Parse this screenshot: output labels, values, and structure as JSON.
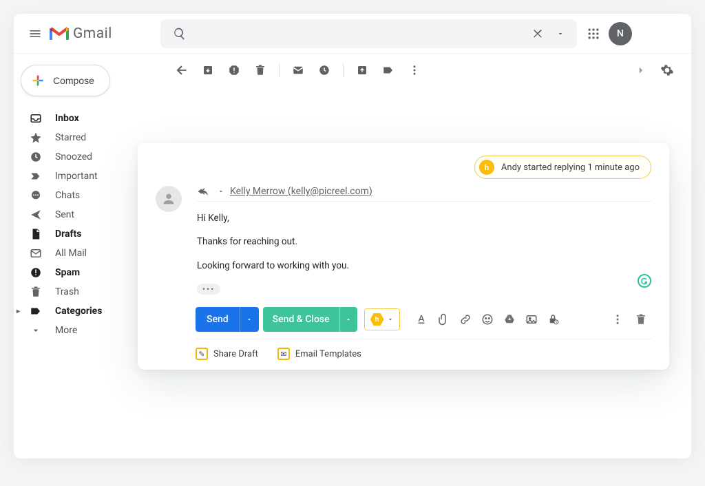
{
  "brand": {
    "name": "Gmail"
  },
  "topbar": {
    "avatar_initial": "N"
  },
  "sidebar": {
    "compose_label": "Compose",
    "items": [
      {
        "label": "Inbox",
        "icon": "inbox",
        "bold": true
      },
      {
        "label": "Starred",
        "icon": "star",
        "bold": false
      },
      {
        "label": "Snoozed",
        "icon": "clock",
        "bold": false
      },
      {
        "label": "Important",
        "icon": "important",
        "bold": false
      },
      {
        "label": "Chats",
        "icon": "chats",
        "bold": false
      },
      {
        "label": "Sent",
        "icon": "sent",
        "bold": false
      },
      {
        "label": "Drafts",
        "icon": "drafts",
        "bold": true
      },
      {
        "label": "All Mail",
        "icon": "allmail",
        "bold": false
      },
      {
        "label": "Spam",
        "icon": "spam",
        "bold": true
      },
      {
        "label": "Trash",
        "icon": "trash",
        "bold": false
      },
      {
        "label": "Categories",
        "icon": "categories",
        "bold": true
      },
      {
        "label": "More",
        "icon": "more",
        "bold": false
      }
    ]
  },
  "activity_pill": {
    "text": "Andy started replying 1 minute ago",
    "badge_letter": "h"
  },
  "compose": {
    "recipient_display": "Kelly Merrow (kelly@picreel.com)",
    "body_line1": "Hi Kelly,",
    "body_line2": "Thanks for reaching out.",
    "body_line3": "Looking forward to working with you.",
    "send_label": "Send",
    "send_close_label": "Send & Close",
    "share_draft_label": "Share Draft",
    "email_templates_label": "Email Templates",
    "hiver_badge_letter": "h"
  }
}
